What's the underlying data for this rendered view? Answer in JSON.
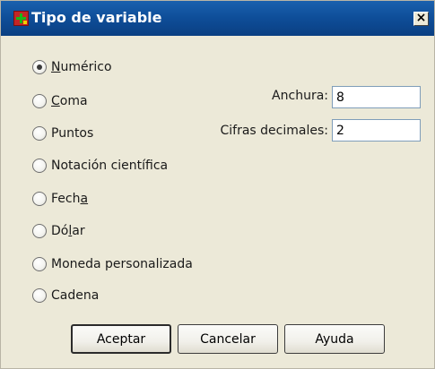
{
  "window": {
    "title": "Tipo de variable",
    "close_symbol": "×"
  },
  "icons": {
    "app": "spss-variable-icon",
    "close": "close-icon"
  },
  "types": {
    "selected": "Numérico",
    "options": [
      {
        "pre": "",
        "u": "N",
        "post": "umérico",
        "checked": true
      },
      {
        "pre": "",
        "u": "C",
        "post": "oma",
        "checked": false
      },
      {
        "pre": "",
        "u": "",
        "post": "Puntos",
        "checked": false
      },
      {
        "pre": "",
        "u": "",
        "post": "Notación científica",
        "checked": false
      },
      {
        "pre": "Fech",
        "u": "a",
        "post": "",
        "checked": false
      },
      {
        "pre": "Dó",
        "u": "l",
        "post": "ar",
        "checked": false
      },
      {
        "pre": "",
        "u": "",
        "post": "Moneda personalizada",
        "checked": false
      },
      {
        "pre": "",
        "u": "",
        "post": "Cadena",
        "checked": false
      }
    ]
  },
  "fields": {
    "width_label": "Anchura:",
    "width_value": "8",
    "decimals_label": "Cifras decimales:",
    "decimals_value": "2"
  },
  "buttons": {
    "ok": "Aceptar",
    "cancel": "Cancelar",
    "help": "Ayuda"
  },
  "colors": {
    "titlebar": "#0e4d98",
    "window_bg": "#ece9d8"
  }
}
